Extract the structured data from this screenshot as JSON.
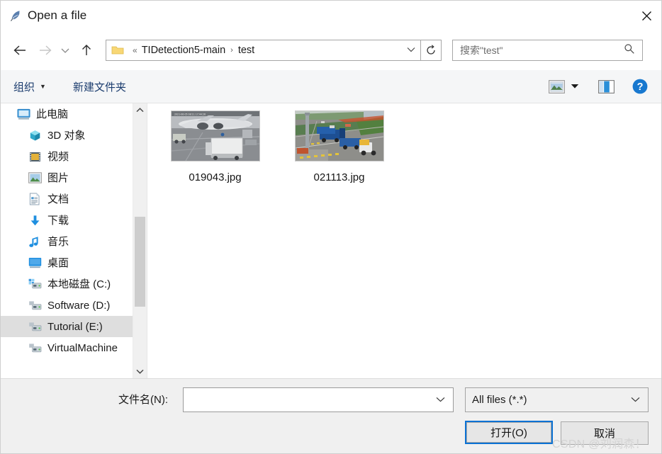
{
  "window": {
    "title": "Open a file",
    "title_icon": "feather-quill-icon",
    "close_label": "✕"
  },
  "nav": {
    "back_label": "←",
    "forward_label": "→",
    "recent_label": "⌄",
    "up_label": "↑",
    "refresh_label": "↻",
    "address": {
      "prefix": "«",
      "crumbs": [
        "TIDetection5-main",
        "test"
      ],
      "separator": "›",
      "dropdown_label": "⌄"
    },
    "search": {
      "placeholder": "搜索\"test\"",
      "icon": "search-icon"
    }
  },
  "toolbar": {
    "organize_label": "组织",
    "organize_caret": "▼",
    "new_folder_label": "新建文件夹",
    "view_icon": "picture-view-icon",
    "view_caret": "▼",
    "preview_pane_icon": "preview-pane-icon",
    "help_icon": "help-question-icon",
    "help_label": "?"
  },
  "sidebar": {
    "items": [
      {
        "label": "此电脑",
        "icon": "this-pc-icon",
        "level": 0,
        "selected": false
      },
      {
        "label": "3D 对象",
        "icon": "3d-objects-icon",
        "level": 1,
        "selected": false
      },
      {
        "label": "视频",
        "icon": "videos-icon",
        "level": 1,
        "selected": false
      },
      {
        "label": "图片",
        "icon": "pictures-icon",
        "level": 1,
        "selected": false
      },
      {
        "label": "文档",
        "icon": "documents-icon",
        "level": 1,
        "selected": false
      },
      {
        "label": "下载",
        "icon": "downloads-icon",
        "level": 1,
        "selected": false
      },
      {
        "label": "音乐",
        "icon": "music-icon",
        "level": 1,
        "selected": false
      },
      {
        "label": "桌面",
        "icon": "desktop-icon",
        "level": 1,
        "selected": false
      },
      {
        "label": "本地磁盘 (C:)",
        "icon": "local-disk-icon",
        "level": 1,
        "selected": false
      },
      {
        "label": "Software (D:)",
        "icon": "drive-icon",
        "level": 1,
        "selected": false
      },
      {
        "label": "Tutorial (E:)",
        "icon": "drive-icon",
        "level": 1,
        "selected": true
      },
      {
        "label": "VirtualMachine",
        "icon": "drive-icon",
        "level": 1,
        "selected": false
      }
    ],
    "scrollbar": {
      "up_arrow": "∧",
      "down_arrow": "∨"
    }
  },
  "files": [
    {
      "name": "019043.jpg",
      "thumbnail": "airport-apron-photo"
    },
    {
      "name": "021113.jpg",
      "thumbnail": "highway-toll-photo"
    }
  ],
  "footer": {
    "filename_label": "文件名(N):",
    "filename_value": "",
    "filename_caret": "⌄",
    "filetype_value": "All files (*.*)",
    "filetype_caret": "⌄",
    "open_label": "打开(O)",
    "cancel_label": "取消"
  },
  "watermark": {
    "text": "CSDN @刘润森！"
  },
  "colors": {
    "accent": "#0b72d4",
    "selection": "#dedede",
    "toolbar_bg": "#f5f6f7",
    "footer_bg": "#f0f0f0",
    "link_text": "#1b3c6e"
  }
}
